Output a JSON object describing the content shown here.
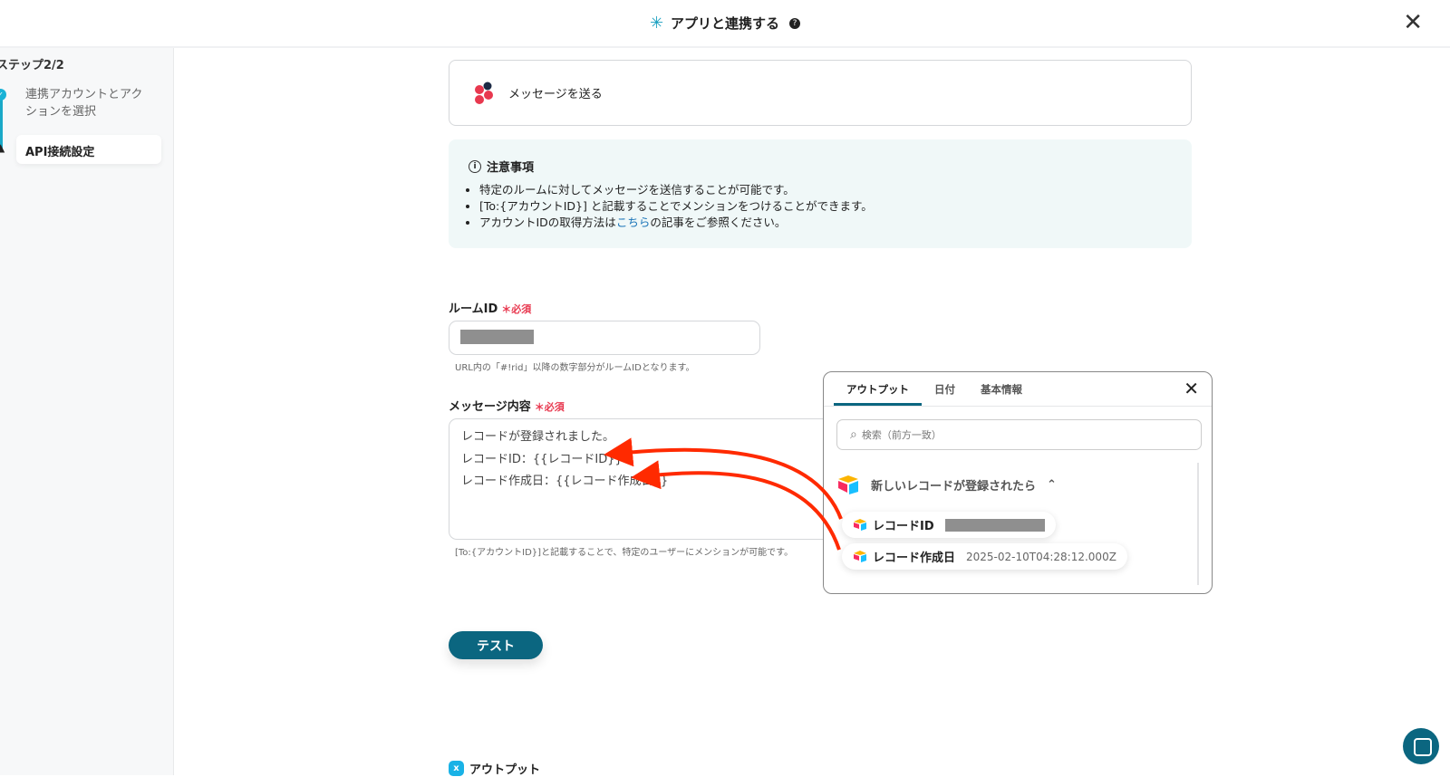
{
  "header": {
    "title": "アプリと連携する",
    "help": "?"
  },
  "sidebar": {
    "step_title": "ステップ2/2",
    "steps": [
      {
        "label": "連携アカウントとアクションを選択",
        "status": "done"
      },
      {
        "label": "API接続設定",
        "status": "warning"
      }
    ]
  },
  "action": {
    "label": "メッセージを送る"
  },
  "notice": {
    "title": "注意事項",
    "items": [
      "特定のルームに対してメッセージを送信することが可能です。",
      "[To:{アカウントID}] と記載することでメンションをつけることができます。"
    ],
    "item3_pre": "アカウントIDの取得方法は",
    "item3_link": "こちら",
    "item3_post": "の記事をご参照ください。"
  },
  "room": {
    "label": "ルームID",
    "required": "必須",
    "hint": "URL内の「#!rid」以降の数字部分がルームIDとなります。"
  },
  "message": {
    "label": "メッセージ内容",
    "required": "必須",
    "lines": [
      "レコードが登録されました。",
      "レコードID：{{レコードID}}",
      "レコード作成日：{{レコード作成日}}"
    ],
    "hint": "[To:{アカウントID}]と記載することで、特定のユーザーにメンションが可能です。"
  },
  "test_button": "テスト",
  "output_label": "アウトプット",
  "popup": {
    "tabs": [
      "アウトプット",
      "日付",
      "基本情報"
    ],
    "search_placeholder": "検索（前方一致）",
    "group": "新しいレコードが登録されたら",
    "items": [
      {
        "label": "レコードID"
      },
      {
        "label": "レコード作成日",
        "value": "2025-02-10T04:28:12.000Z"
      }
    ]
  },
  "colors": {
    "primary": "#0b6680",
    "required": "#e8384f",
    "arrow": "#ff2a00"
  }
}
